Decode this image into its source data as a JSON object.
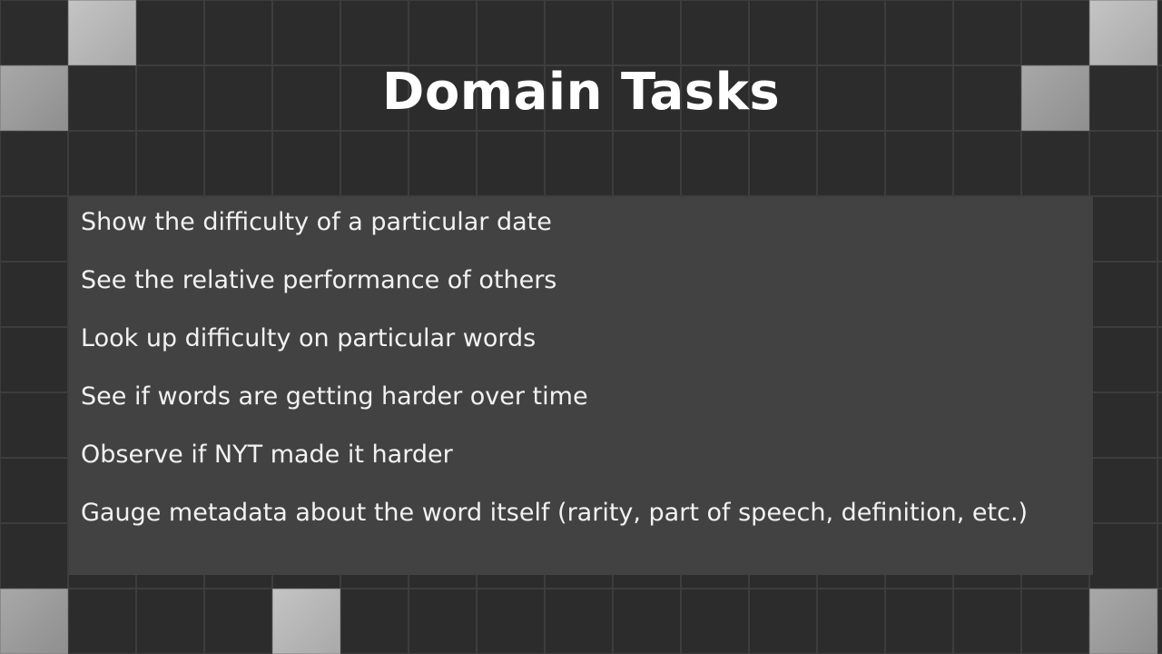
{
  "slide": {
    "title": "Domain Tasks",
    "tasks": [
      "Show the difficulty of a particular date",
      "See the relative performance of others",
      "Look up difficulty on particular words",
      "See if words are getting harder over time",
      "Observe if NYT made it harder",
      "Gauge metadata about the word itself (rarity, part of speech, definition, etc.)"
    ]
  },
  "colors": {
    "background": "#272727",
    "tile": "#2c2c2c",
    "tile_highlight": "#b5b5b5",
    "panel": "#424242",
    "text": "#ffffff"
  }
}
